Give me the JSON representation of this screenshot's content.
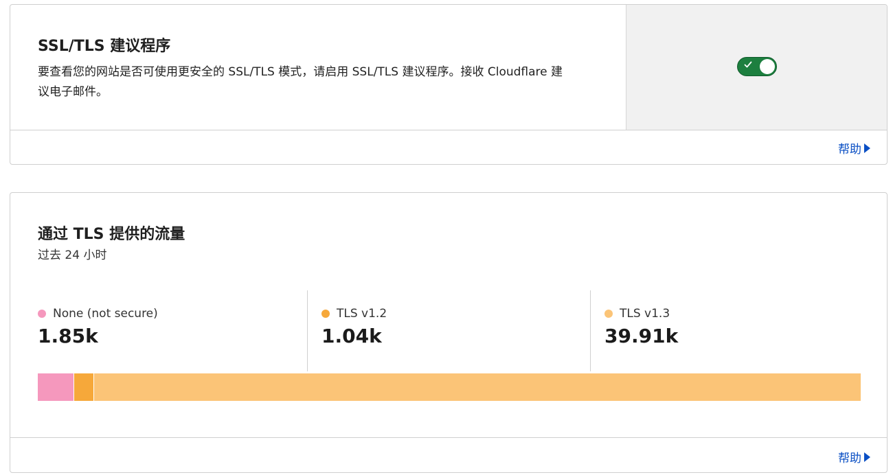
{
  "ssl_recommender": {
    "title": "SSL/TLS 建议程序",
    "description": "要查看您的网站是否可使用更安全的 SSL/TLS 模式，请启用 SSL/TLS 建议程序。接收 Cloudflare 建议电子邮件。",
    "toggle_enabled": true,
    "toggle_color": "#1d7f3f",
    "help_label": "帮助"
  },
  "tls_traffic": {
    "title": "通过 TLS 提供的流量",
    "subtitle": "过去 24 小时",
    "help_label": "帮助"
  },
  "chart_data": {
    "type": "bar",
    "orientation": "horizontal-stacked",
    "series": [
      {
        "name": "None (not secure)",
        "value": 1.85,
        "display": "1.85k",
        "color": "#f598bd"
      },
      {
        "name": "TLS v1.2",
        "value": 1.04,
        "display": "1.04k",
        "color": "#f6a83a"
      },
      {
        "name": "TLS v1.3",
        "value": 39.91,
        "display": "39.91k",
        "color": "#fbc477"
      }
    ]
  },
  "icons": {
    "toggle_check": "check-icon",
    "help_arrow": "caret-right-icon",
    "legend_marker": "circle-dot-icon"
  }
}
